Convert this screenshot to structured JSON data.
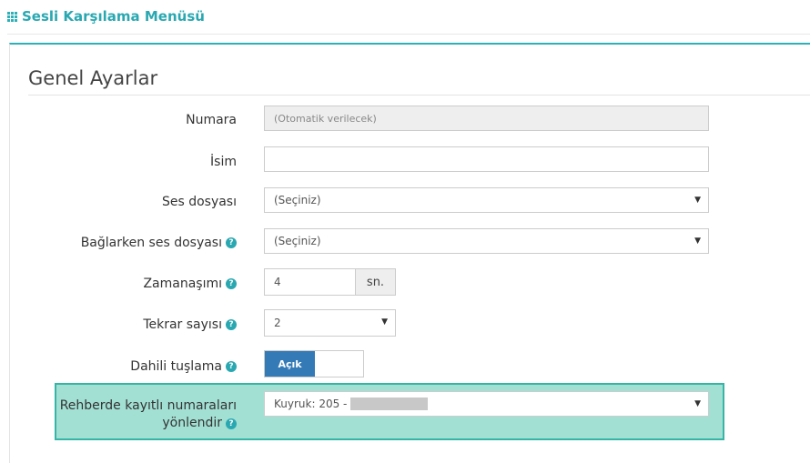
{
  "header": {
    "title": "Sesli Karşılama Menüsü",
    "icon": "grid-icon"
  },
  "section": {
    "title": "Genel Ayarlar"
  },
  "fields": {
    "numara": {
      "label": "Numara",
      "value": "(Otomatik verilecek)"
    },
    "isim": {
      "label": "İsim",
      "value": ""
    },
    "ses_dosyasi": {
      "label": "Ses dosyası",
      "selected": "(Seçiniz)"
    },
    "baglarken": {
      "label": "Bağlarken ses dosyası",
      "selected": "(Seçiniz)"
    },
    "zamanasimi": {
      "label": "Zamanaşımı",
      "value": "4",
      "addon": "sn."
    },
    "tekrar": {
      "label": "Tekrar sayısı",
      "selected": "2"
    },
    "dahili": {
      "label": "Dahili tuşlama",
      "toggle_label": "Açık"
    },
    "rehber": {
      "label_line1": "Rehberde kayıtlı numaraları",
      "label_line2": "yönlendir",
      "selected": "Kuyruk: 205 -"
    }
  },
  "icons": {
    "help": "?",
    "caret": "▼"
  },
  "colors": {
    "accent": "#2aa8b1",
    "toggle_on": "#337ab7",
    "highlight": "#a3e0d4"
  }
}
